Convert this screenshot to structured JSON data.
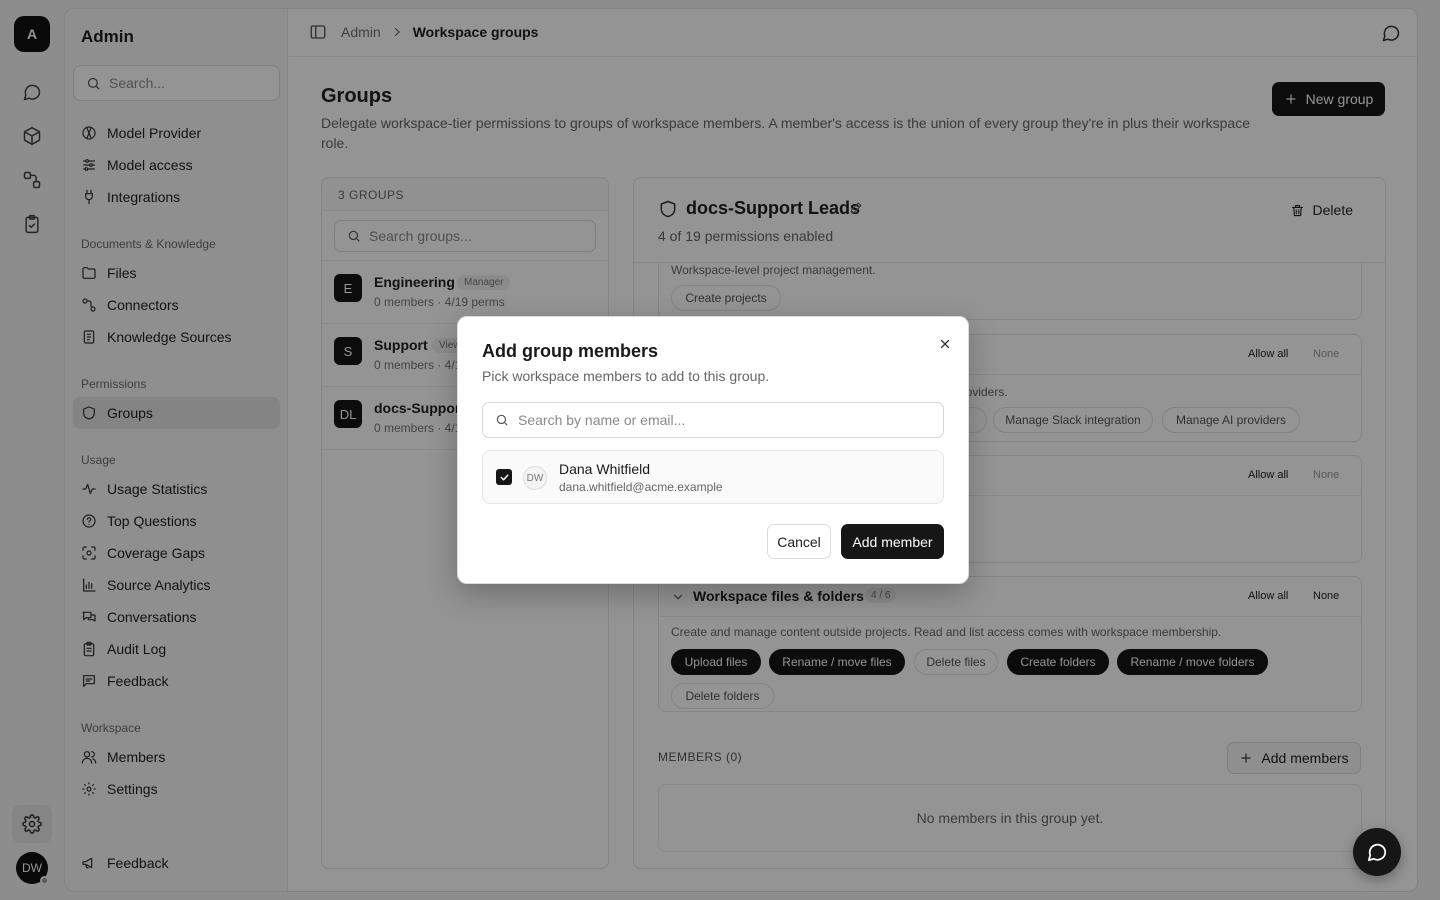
{
  "rail": {
    "logo": "A",
    "icons": [
      "chat-icon",
      "cube-icon",
      "workflow-icon",
      "clipboard-check-icon"
    ],
    "settings_icon": "gear-icon",
    "avatar": "DW"
  },
  "sidebar": {
    "title": "Admin",
    "search_placeholder": "Search...",
    "top_items": [
      {
        "label": "Model Provider",
        "icon": "provider-icon"
      },
      {
        "label": "Model access",
        "icon": "sliders-icon"
      },
      {
        "label": "Integrations",
        "icon": "plug-icon"
      }
    ],
    "sections": [
      {
        "title": "Documents & Knowledge",
        "items": [
          {
            "label": "Files",
            "icon": "folder-icon"
          },
          {
            "label": "Connectors",
            "icon": "connector-icon"
          },
          {
            "label": "Knowledge Sources",
            "icon": "book-icon"
          }
        ]
      },
      {
        "title": "Permissions",
        "items": [
          {
            "label": "Groups",
            "icon": "shield-icon",
            "active": true
          }
        ]
      },
      {
        "title": "Usage",
        "items": [
          {
            "label": "Usage Statistics",
            "icon": "activity-icon"
          },
          {
            "label": "Top Questions",
            "icon": "help-circle-icon"
          },
          {
            "label": "Coverage Gaps",
            "icon": "scan-icon"
          },
          {
            "label": "Source Analytics",
            "icon": "bar-chart-icon"
          },
          {
            "label": "Conversations",
            "icon": "messages-icon"
          },
          {
            "label": "Audit Log",
            "icon": "clipboard-list-icon"
          },
          {
            "label": "Feedback",
            "icon": "message-square-icon"
          }
        ]
      },
      {
        "title": "Workspace",
        "items": [
          {
            "label": "Members",
            "icon": "users-icon"
          },
          {
            "label": "Settings",
            "icon": "gear-icon"
          }
        ]
      }
    ],
    "footer_item": {
      "label": "Feedback",
      "icon": "megaphone-icon"
    }
  },
  "topbar": {
    "breadcrumb": [
      "Admin",
      "Workspace groups"
    ]
  },
  "page": {
    "title": "Groups",
    "description": "Delegate workspace-tier permissions to groups of workspace members. A member's access is the union of every group they're in plus their workspace role.",
    "new_group_label": "New group"
  },
  "groups_panel": {
    "header": "3 GROUPS",
    "search_placeholder": "Search groups...",
    "groups": [
      {
        "avatar": "E",
        "name": "Engineering",
        "badge": "Manager",
        "meta": "0 members · 4/19 perms"
      },
      {
        "avatar": "S",
        "name": "Support",
        "badge": "Viewer",
        "meta": "0 members · 4/19 perms"
      },
      {
        "avatar": "DL",
        "name": "docs-Support Leads",
        "badge": "",
        "meta": "0 members · 4/19 perms"
      }
    ]
  },
  "detail": {
    "name": "docs-Support Leads",
    "subtitle": "4 of 19 permissions enabled",
    "delete_label": "Delete",
    "card1": {
      "desc": "Workspace-level project management.",
      "chips": [
        {
          "label": "Create projects",
          "on": false
        }
      ]
    },
    "card2": {
      "allow_all": "Allow all",
      "none": "None",
      "desc_tail": "providers.",
      "chips": [
        {
          "label": "s",
          "on": false
        },
        {
          "label": "Manage Slack integration",
          "on": false
        },
        {
          "label": "Manage AI providers",
          "on": false
        }
      ]
    },
    "card3": {
      "allow_all": "Allow all",
      "none": "None",
      "desc_tail": "."
    },
    "card4": {
      "title": "Workspace files & folders",
      "count": "4 / 6",
      "allow_all": "Allow all",
      "none": "None",
      "desc": "Create and manage content outside projects. Read and list access comes with workspace membership.",
      "chips": [
        {
          "label": "Upload files",
          "on": true
        },
        {
          "label": "Rename / move files",
          "on": true
        },
        {
          "label": "Delete files",
          "on": false
        },
        {
          "label": "Create folders",
          "on": true
        },
        {
          "label": "Rename / move folders",
          "on": true
        },
        {
          "label": "Delete folders",
          "on": false
        }
      ]
    },
    "members_label": "MEMBERS (0)",
    "add_members_label": "Add members",
    "members_empty": "No members in this group yet."
  },
  "modal": {
    "title": "Add group members",
    "subtitle": "Pick workspace members to add to this group.",
    "search_placeholder": "Search by name or email...",
    "candidate": {
      "initials": "DW",
      "name": "Dana Whitfield",
      "email": "dana.whitfield@acme.example",
      "checked": true
    },
    "cancel_label": "Cancel",
    "confirm_label": "Add member"
  },
  "colors": {
    "primary": "#161616",
    "overlay": "rgba(0,0,0,0.42)",
    "active_nav": "#e4e4e4"
  }
}
